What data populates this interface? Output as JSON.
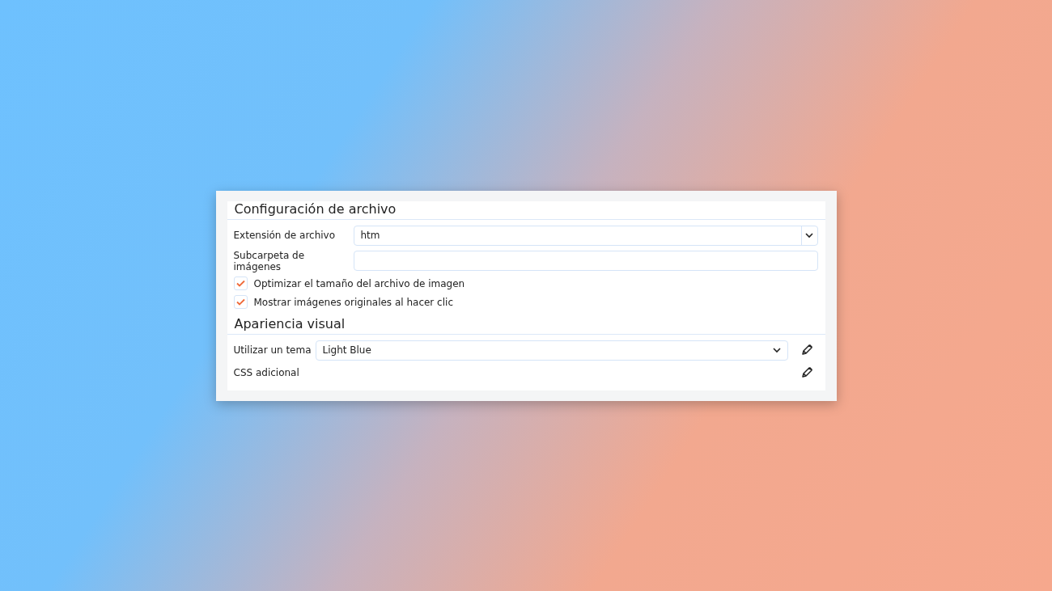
{
  "sections": [
    {
      "title": "Configuración de archivo",
      "rows": [
        {
          "kind": "select",
          "label": "Extensión de archivo",
          "value": "htm"
        },
        {
          "kind": "text",
          "label": "Subcarpeta de imágenes"
        },
        {
          "kind": "checkbox",
          "label": "Optimizar el tamaño del archivo de imagen",
          "checked": true
        },
        {
          "kind": "checkbox",
          "label": "Mostrar imágenes originales al hacer clic",
          "checked": true
        }
      ]
    },
    {
      "title": "Apariencia visual",
      "rows": [
        {
          "kind": "select-edit",
          "label": "Utilizar un tema",
          "value": "Light Blue"
        },
        {
          "kind": "edit",
          "label": "CSS adicional"
        }
      ]
    }
  ]
}
